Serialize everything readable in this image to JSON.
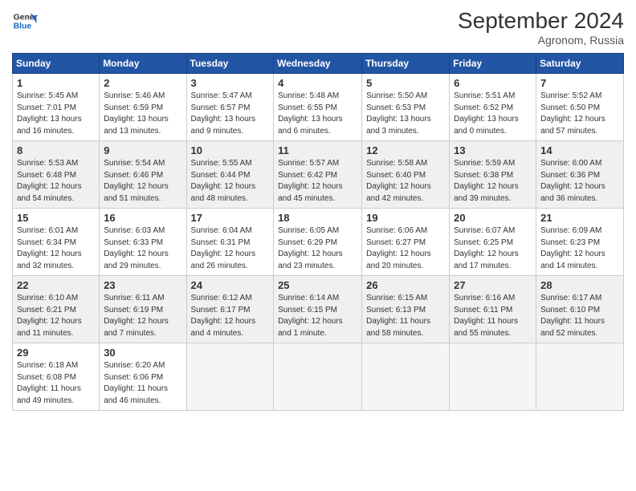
{
  "logo": {
    "text_line1": "General",
    "text_line2": "Blue"
  },
  "title": "September 2024",
  "location": "Agronom, Russia",
  "days_header": [
    "Sunday",
    "Monday",
    "Tuesday",
    "Wednesday",
    "Thursday",
    "Friday",
    "Saturday"
  ],
  "weeks": [
    [
      {
        "day": "1",
        "info": "Sunrise: 5:45 AM\nSunset: 7:01 PM\nDaylight: 13 hours\nand 16 minutes."
      },
      {
        "day": "2",
        "info": "Sunrise: 5:46 AM\nSunset: 6:59 PM\nDaylight: 13 hours\nand 13 minutes."
      },
      {
        "day": "3",
        "info": "Sunrise: 5:47 AM\nSunset: 6:57 PM\nDaylight: 13 hours\nand 9 minutes."
      },
      {
        "day": "4",
        "info": "Sunrise: 5:48 AM\nSunset: 6:55 PM\nDaylight: 13 hours\nand 6 minutes."
      },
      {
        "day": "5",
        "info": "Sunrise: 5:50 AM\nSunset: 6:53 PM\nDaylight: 13 hours\nand 3 minutes."
      },
      {
        "day": "6",
        "info": "Sunrise: 5:51 AM\nSunset: 6:52 PM\nDaylight: 13 hours\nand 0 minutes."
      },
      {
        "day": "7",
        "info": "Sunrise: 5:52 AM\nSunset: 6:50 PM\nDaylight: 12 hours\nand 57 minutes."
      }
    ],
    [
      {
        "day": "8",
        "info": "Sunrise: 5:53 AM\nSunset: 6:48 PM\nDaylight: 12 hours\nand 54 minutes."
      },
      {
        "day": "9",
        "info": "Sunrise: 5:54 AM\nSunset: 6:46 PM\nDaylight: 12 hours\nand 51 minutes."
      },
      {
        "day": "10",
        "info": "Sunrise: 5:55 AM\nSunset: 6:44 PM\nDaylight: 12 hours\nand 48 minutes."
      },
      {
        "day": "11",
        "info": "Sunrise: 5:57 AM\nSunset: 6:42 PM\nDaylight: 12 hours\nand 45 minutes."
      },
      {
        "day": "12",
        "info": "Sunrise: 5:58 AM\nSunset: 6:40 PM\nDaylight: 12 hours\nand 42 minutes."
      },
      {
        "day": "13",
        "info": "Sunrise: 5:59 AM\nSunset: 6:38 PM\nDaylight: 12 hours\nand 39 minutes."
      },
      {
        "day": "14",
        "info": "Sunrise: 6:00 AM\nSunset: 6:36 PM\nDaylight: 12 hours\nand 36 minutes."
      }
    ],
    [
      {
        "day": "15",
        "info": "Sunrise: 6:01 AM\nSunset: 6:34 PM\nDaylight: 12 hours\nand 32 minutes."
      },
      {
        "day": "16",
        "info": "Sunrise: 6:03 AM\nSunset: 6:33 PM\nDaylight: 12 hours\nand 29 minutes."
      },
      {
        "day": "17",
        "info": "Sunrise: 6:04 AM\nSunset: 6:31 PM\nDaylight: 12 hours\nand 26 minutes."
      },
      {
        "day": "18",
        "info": "Sunrise: 6:05 AM\nSunset: 6:29 PM\nDaylight: 12 hours\nand 23 minutes."
      },
      {
        "day": "19",
        "info": "Sunrise: 6:06 AM\nSunset: 6:27 PM\nDaylight: 12 hours\nand 20 minutes."
      },
      {
        "day": "20",
        "info": "Sunrise: 6:07 AM\nSunset: 6:25 PM\nDaylight: 12 hours\nand 17 minutes."
      },
      {
        "day": "21",
        "info": "Sunrise: 6:09 AM\nSunset: 6:23 PM\nDaylight: 12 hours\nand 14 minutes."
      }
    ],
    [
      {
        "day": "22",
        "info": "Sunrise: 6:10 AM\nSunset: 6:21 PM\nDaylight: 12 hours\nand 11 minutes."
      },
      {
        "day": "23",
        "info": "Sunrise: 6:11 AM\nSunset: 6:19 PM\nDaylight: 12 hours\nand 7 minutes."
      },
      {
        "day": "24",
        "info": "Sunrise: 6:12 AM\nSunset: 6:17 PM\nDaylight: 12 hours\nand 4 minutes."
      },
      {
        "day": "25",
        "info": "Sunrise: 6:14 AM\nSunset: 6:15 PM\nDaylight: 12 hours\nand 1 minute."
      },
      {
        "day": "26",
        "info": "Sunrise: 6:15 AM\nSunset: 6:13 PM\nDaylight: 11 hours\nand 58 minutes."
      },
      {
        "day": "27",
        "info": "Sunrise: 6:16 AM\nSunset: 6:11 PM\nDaylight: 11 hours\nand 55 minutes."
      },
      {
        "day": "28",
        "info": "Sunrise: 6:17 AM\nSunset: 6:10 PM\nDaylight: 11 hours\nand 52 minutes."
      }
    ],
    [
      {
        "day": "29",
        "info": "Sunrise: 6:18 AM\nSunset: 6:08 PM\nDaylight: 11 hours\nand 49 minutes."
      },
      {
        "day": "30",
        "info": "Sunrise: 6:20 AM\nSunset: 6:06 PM\nDaylight: 11 hours\nand 46 minutes."
      },
      {
        "day": "",
        "info": ""
      },
      {
        "day": "",
        "info": ""
      },
      {
        "day": "",
        "info": ""
      },
      {
        "day": "",
        "info": ""
      },
      {
        "day": "",
        "info": ""
      }
    ]
  ]
}
